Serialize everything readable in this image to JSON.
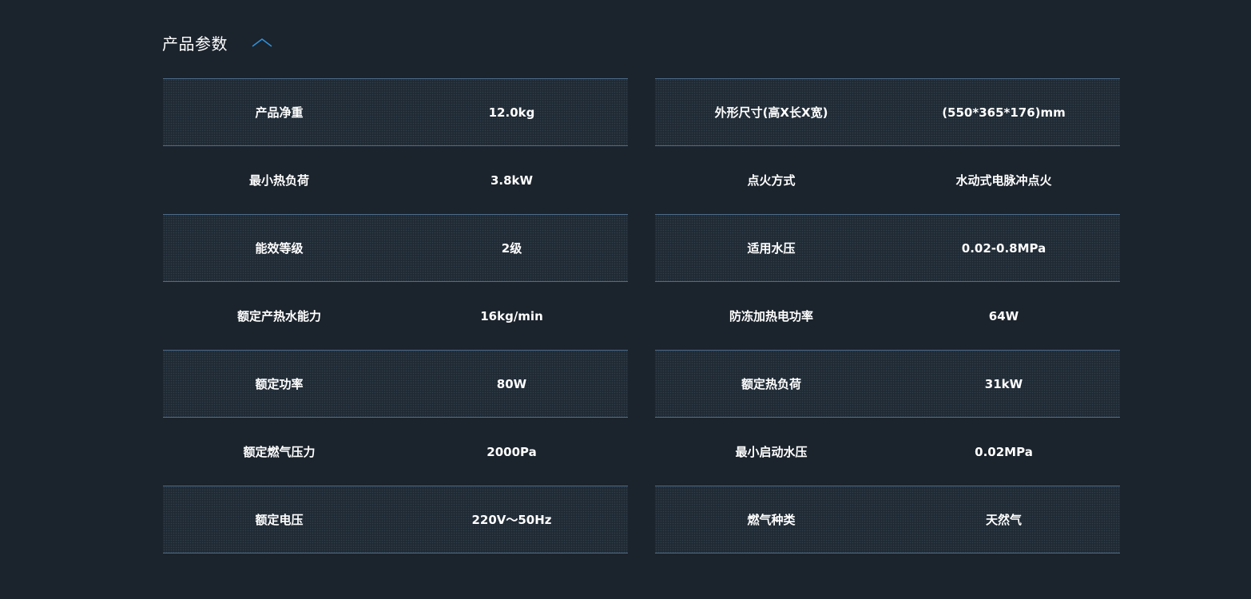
{
  "section": {
    "title": "产品参数"
  },
  "specs": {
    "left": [
      {
        "label": "产品净重",
        "value": "12.0kg"
      },
      {
        "label": "最小热负荷",
        "value": "3.8kW"
      },
      {
        "label": "能效等级",
        "value": "2级"
      },
      {
        "label": "额定产热水能力",
        "value": "16kg/min"
      },
      {
        "label": "额定功率",
        "value": "80W"
      },
      {
        "label": "额定燃气压力",
        "value": "2000Pa"
      },
      {
        "label": "额定电压",
        "value": "220V～50Hz"
      }
    ],
    "right": [
      {
        "label": "外形尺寸(高X长X宽)",
        "value": "(550*365*176)mm"
      },
      {
        "label": "点火方式",
        "value": "水动式电脉冲点火"
      },
      {
        "label": "适用水压",
        "value": "0.02-0.8MPa"
      },
      {
        "label": "防冻加热电功率",
        "value": "64W"
      },
      {
        "label": "额定热负荷",
        "value": "31kW"
      },
      {
        "label": "最小启动水压",
        "value": "0.02MPa"
      },
      {
        "label": "燃气种类",
        "value": "天然气"
      }
    ]
  },
  "colors": {
    "background": "#1b232c",
    "accent": "#2f8fd6",
    "row_border": "#4d6c8a"
  },
  "icons": {
    "collapse": "chevron-up-icon"
  }
}
